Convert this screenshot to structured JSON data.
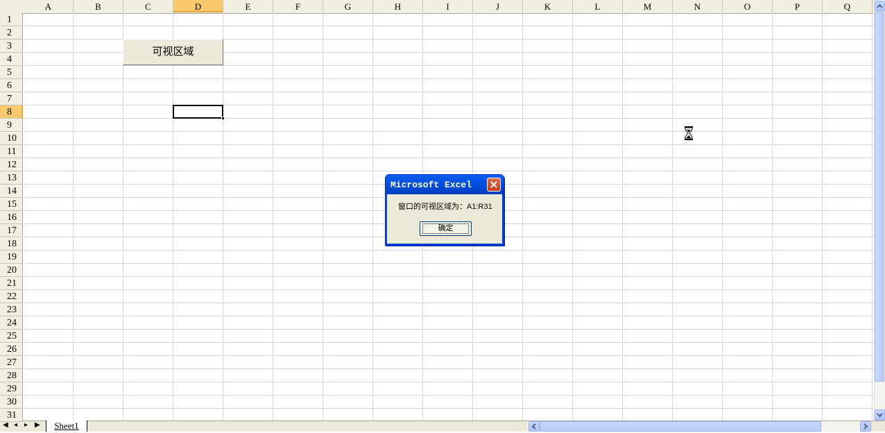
{
  "columns": [
    "A",
    "B",
    "C",
    "D",
    "E",
    "F",
    "G",
    "H",
    "I",
    "J",
    "K",
    "L",
    "M",
    "N",
    "O",
    "P",
    "Q"
  ],
  "rows": [
    "1",
    "2",
    "3",
    "4",
    "5",
    "6",
    "7",
    "8",
    "9",
    "10",
    "11",
    "12",
    "13",
    "14",
    "15",
    "16",
    "17",
    "18",
    "19",
    "20",
    "21",
    "22",
    "23",
    "24",
    "25",
    "26",
    "27",
    "28",
    "29",
    "30",
    "31"
  ],
  "selected_column": "D",
  "selected_row": "8",
  "sheet_button": {
    "label": "可视区域"
  },
  "dialog": {
    "title": "Microsoft Excel",
    "message": "窗口的可视区域为：A1:R31",
    "ok_label": "确定"
  },
  "sheet_tabs": [
    {
      "label": "Sheet1"
    }
  ],
  "tab_nav": {
    "first": "◀",
    "prev": "◂",
    "next": "▸",
    "last": "▶"
  },
  "colors": {
    "header_bg": "#f1efe2",
    "selected_header": "#f9c96d",
    "dialog_title": "#0147d4",
    "close_button": "#c3391b"
  },
  "icons": {
    "cursor": "hourglass-icon"
  }
}
